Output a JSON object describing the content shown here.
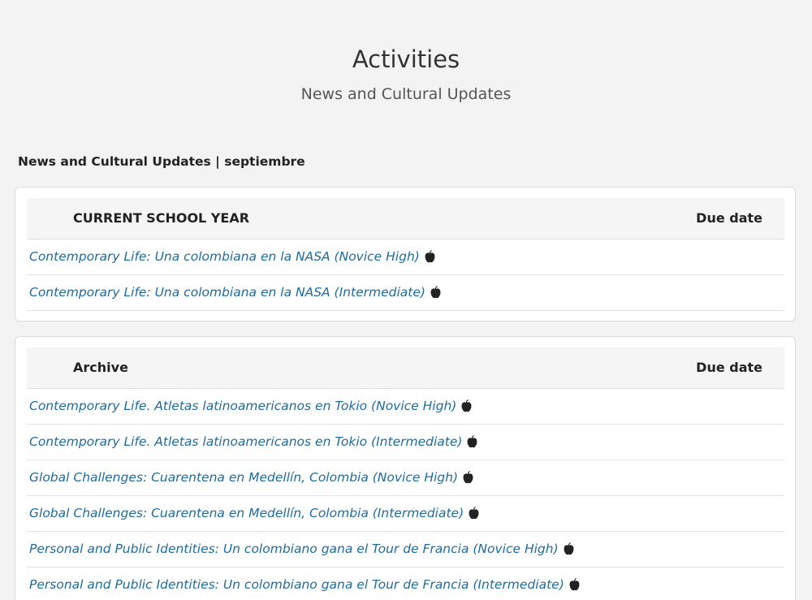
{
  "page": {
    "title": "Activities",
    "subtitle": "News and Cultural Updates"
  },
  "section": {
    "heading": "News and Cultural Updates | septiembre"
  },
  "current_table": {
    "header": "CURRENT SCHOOL YEAR",
    "due_header": "Due date",
    "rows": [
      {
        "title": "Contemporary Life: Una colombiana en la NASA (Novice High)",
        "icon": "apple-icon"
      },
      {
        "title": "Contemporary Life: Una colombiana en la NASA (Intermediate)",
        "icon": "apple-icon"
      }
    ]
  },
  "archive_table": {
    "header": "Archive",
    "due_header": "Due date",
    "rows": [
      {
        "title": "Contemporary Life. Atletas latinoamericanos en Tokio (Novice High)",
        "icon": "apple-icon"
      },
      {
        "title": "Contemporary Life. Atletas latinoamericanos en Tokio (Intermediate)",
        "icon": "apple-icon"
      },
      {
        "title": "Global Challenges: Cuarentena en Medellín, Colombia (Novice High)",
        "icon": "apple-icon"
      },
      {
        "title": "Global Challenges: Cuarentena en Medellín, Colombia (Intermediate)",
        "icon": "apple-icon"
      },
      {
        "title": "Personal and Public Identities: Un colombiano gana el Tour de Francia (Novice High)",
        "icon": "apple-icon"
      },
      {
        "title": "Personal and Public Identities: Un colombiano gana el Tour de Francia (Intermediate)",
        "icon": "apple-icon"
      }
    ]
  },
  "colors": {
    "background": "#f3f3f3",
    "link": "#1e6b9e",
    "header_bg": "#f5f5f5"
  }
}
